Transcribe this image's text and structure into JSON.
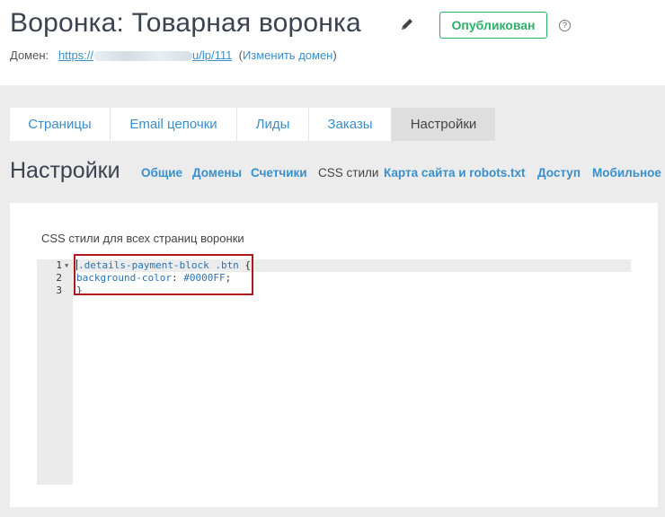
{
  "header": {
    "title": "Воронка: Товарная воронка",
    "status_label": "Опубликован",
    "help_symbol": "?",
    "domain_label": "Домен:",
    "domain_url_start": "https://",
    "domain_url_end": "u/lp/111",
    "change_domain_label": "Изменить домен"
  },
  "tabs": [
    {
      "label": "Страницы",
      "active": false
    },
    {
      "label": "Email цепочки",
      "active": false
    },
    {
      "label": "Лиды",
      "active": false
    },
    {
      "label": "Заказы",
      "active": false
    },
    {
      "label": "Настройки",
      "active": true
    }
  ],
  "section": {
    "title": "Настройки",
    "subnav": [
      {
        "label": "Общие",
        "active": false
      },
      {
        "label": "Домены",
        "active": false
      },
      {
        "label": "Счетчики",
        "active": false
      },
      {
        "label": "CSS стили",
        "active": true
      },
      {
        "label": "Карта сайта и robots.txt",
        "active": false
      },
      {
        "label": "Доступ",
        "active": false
      },
      {
        "label": "Мобильное",
        "active": false
      }
    ]
  },
  "editor": {
    "label": "CSS стили для всех страниц воронки",
    "lines": [
      {
        "number": "1",
        "selector": ".details-payment-block .btn",
        "brace": " {"
      },
      {
        "number": "2",
        "property": "background-color",
        "value": "#0000FF"
      },
      {
        "number": "3",
        "text": "}"
      }
    ]
  },
  "colors": {
    "accent": "#3a8fcb",
    "status_green": "#2eaf66",
    "highlight_red": "#b0181e",
    "background_gray": "#ececec"
  },
  "icons": [
    "pencil-icon",
    "help-icon",
    "fold-arrow-icon"
  ]
}
